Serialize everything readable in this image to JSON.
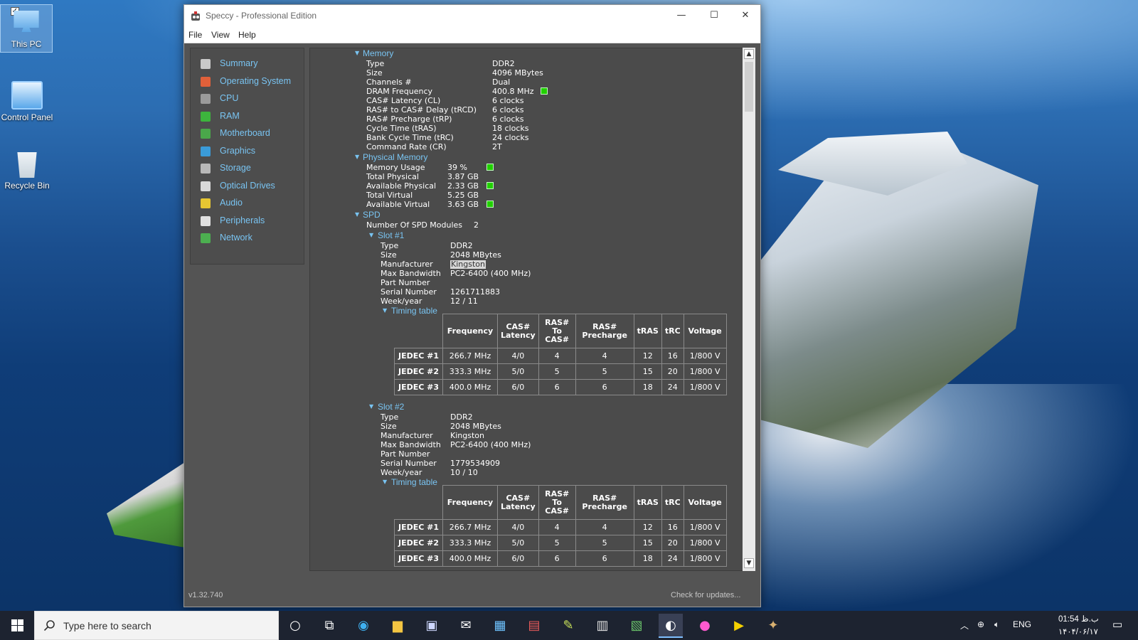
{
  "desktop": {
    "icons": [
      {
        "label": "This PC"
      },
      {
        "label": "Control Panel"
      },
      {
        "label": "Recycle Bin"
      }
    ]
  },
  "window": {
    "title": "Speccy - Professional Edition",
    "controls": {
      "minimize": "—",
      "maximize": "☐",
      "close": "✕"
    },
    "menu": [
      "File",
      "View",
      "Help"
    ],
    "version": "v1.32.740",
    "check_updates": "Check for updates..."
  },
  "sidebar": {
    "items": [
      {
        "label": "Summary",
        "icon": "summary-icon",
        "color": "#c9c9c9"
      },
      {
        "label": "Operating System",
        "icon": "windows-icon",
        "color": "#e0603a"
      },
      {
        "label": "CPU",
        "icon": "cpu-icon",
        "color": "#9a9a9a"
      },
      {
        "label": "RAM",
        "icon": "ram-icon",
        "color": "#3db53d"
      },
      {
        "label": "Motherboard",
        "icon": "motherboard-icon",
        "color": "#4aa84a"
      },
      {
        "label": "Graphics",
        "icon": "graphics-icon",
        "color": "#3a9bd8"
      },
      {
        "label": "Storage",
        "icon": "storage-icon",
        "color": "#b8b8b8"
      },
      {
        "label": "Optical Drives",
        "icon": "optical-drive-icon",
        "color": "#d9d9d9"
      },
      {
        "label": "Audio",
        "icon": "audio-icon",
        "color": "#e6c632"
      },
      {
        "label": "Peripherals",
        "icon": "peripherals-icon",
        "color": "#e0e0e0"
      },
      {
        "label": "Network",
        "icon": "network-icon",
        "color": "#4caf50"
      }
    ]
  },
  "memory": {
    "heading": "Memory",
    "rows": [
      {
        "label": "Type",
        "value": "DDR2"
      },
      {
        "label": "Size",
        "value": "4096 MBytes"
      },
      {
        "label": "Channels #",
        "value": "Dual"
      },
      {
        "label": "DRAM Frequency",
        "value": "400.8 MHz"
      },
      {
        "label": "CAS# Latency (CL)",
        "value": "6 clocks"
      },
      {
        "label": "RAS# to CAS# Delay (tRCD)",
        "value": "6 clocks"
      },
      {
        "label": "RAS# Precharge (tRP)",
        "value": "6 clocks"
      },
      {
        "label": "Cycle Time (tRAS)",
        "value": "18 clocks"
      },
      {
        "label": "Bank Cycle Time (tRC)",
        "value": "24 clocks"
      },
      {
        "label": "Command Rate (CR)",
        "value": "2T"
      }
    ]
  },
  "physical_memory": {
    "heading": "Physical Memory",
    "rows": [
      {
        "label": "Memory Usage",
        "value": "39 %"
      },
      {
        "label": "Total Physical",
        "value": "3.87 GB"
      },
      {
        "label": "Available Physical",
        "value": "2.33 GB"
      },
      {
        "label": "Total Virtual",
        "value": "5.25 GB"
      },
      {
        "label": "Available Virtual",
        "value": "3.63 GB"
      }
    ]
  },
  "spd": {
    "heading": "SPD",
    "modules_label": "Number Of SPD Modules",
    "modules_value": "2",
    "timing_heading": "Timing table",
    "timing_headers": [
      "Frequency",
      "CAS# Latency",
      "RAS# To CAS#",
      "RAS# Precharge",
      "tRAS",
      "tRC",
      "Voltage"
    ],
    "slots": [
      {
        "heading": "Slot #1",
        "rows": [
          {
            "label": "Type",
            "value": "DDR2"
          },
          {
            "label": "Size",
            "value": "2048 MBytes"
          },
          {
            "label": "Manufacturer",
            "value": "Kingston"
          },
          {
            "label": "Max Bandwidth",
            "value": "PC2-6400 (400 MHz)"
          },
          {
            "label": "Part Number",
            "value": ""
          },
          {
            "label": "Serial Number",
            "value": "1261711883"
          },
          {
            "label": "Week/year",
            "value": "12 / 11"
          }
        ],
        "timing": [
          [
            "JEDEC #1",
            "266.7 MHz",
            "4/0",
            "4",
            "4",
            "12",
            "16",
            "1/800 V"
          ],
          [
            "JEDEC #2",
            "333.3 MHz",
            "5/0",
            "5",
            "5",
            "15",
            "20",
            "1/800 V"
          ],
          [
            "JEDEC #3",
            "400.0 MHz",
            "6/0",
            "6",
            "6",
            "18",
            "24",
            "1/800 V"
          ]
        ]
      },
      {
        "heading": "Slot #2",
        "rows": [
          {
            "label": "Type",
            "value": "DDR2"
          },
          {
            "label": "Size",
            "value": "2048 MBytes"
          },
          {
            "label": "Manufacturer",
            "value": "Kingston"
          },
          {
            "label": "Max Bandwidth",
            "value": "PC2-6400 (400 MHz)"
          },
          {
            "label": "Part Number",
            "value": ""
          },
          {
            "label": "Serial Number",
            "value": "1779534909"
          },
          {
            "label": "Week/year",
            "value": "10 / 10"
          }
        ],
        "timing": [
          [
            "JEDEC #1",
            "266.7 MHz",
            "4/0",
            "4",
            "4",
            "12",
            "16",
            "1/800 V"
          ],
          [
            "JEDEC #2",
            "333.3 MHz",
            "5/0",
            "5",
            "5",
            "15",
            "20",
            "1/800 V"
          ],
          [
            "JEDEC #3",
            "400.0 MHz",
            "6/0",
            "6",
            "6",
            "18",
            "24",
            "1/800 V"
          ]
        ]
      }
    ]
  },
  "taskbar": {
    "search_placeholder": "Type here to search",
    "tray_lang": "ENG",
    "clock_time": "01:54 ب.ظ",
    "clock_date": "۱۴۰۴/۰۶/۱۷"
  },
  "colors": {
    "accent": "#79c4f2",
    "indicator": "#22d000",
    "panel": "#4b4b4b"
  }
}
